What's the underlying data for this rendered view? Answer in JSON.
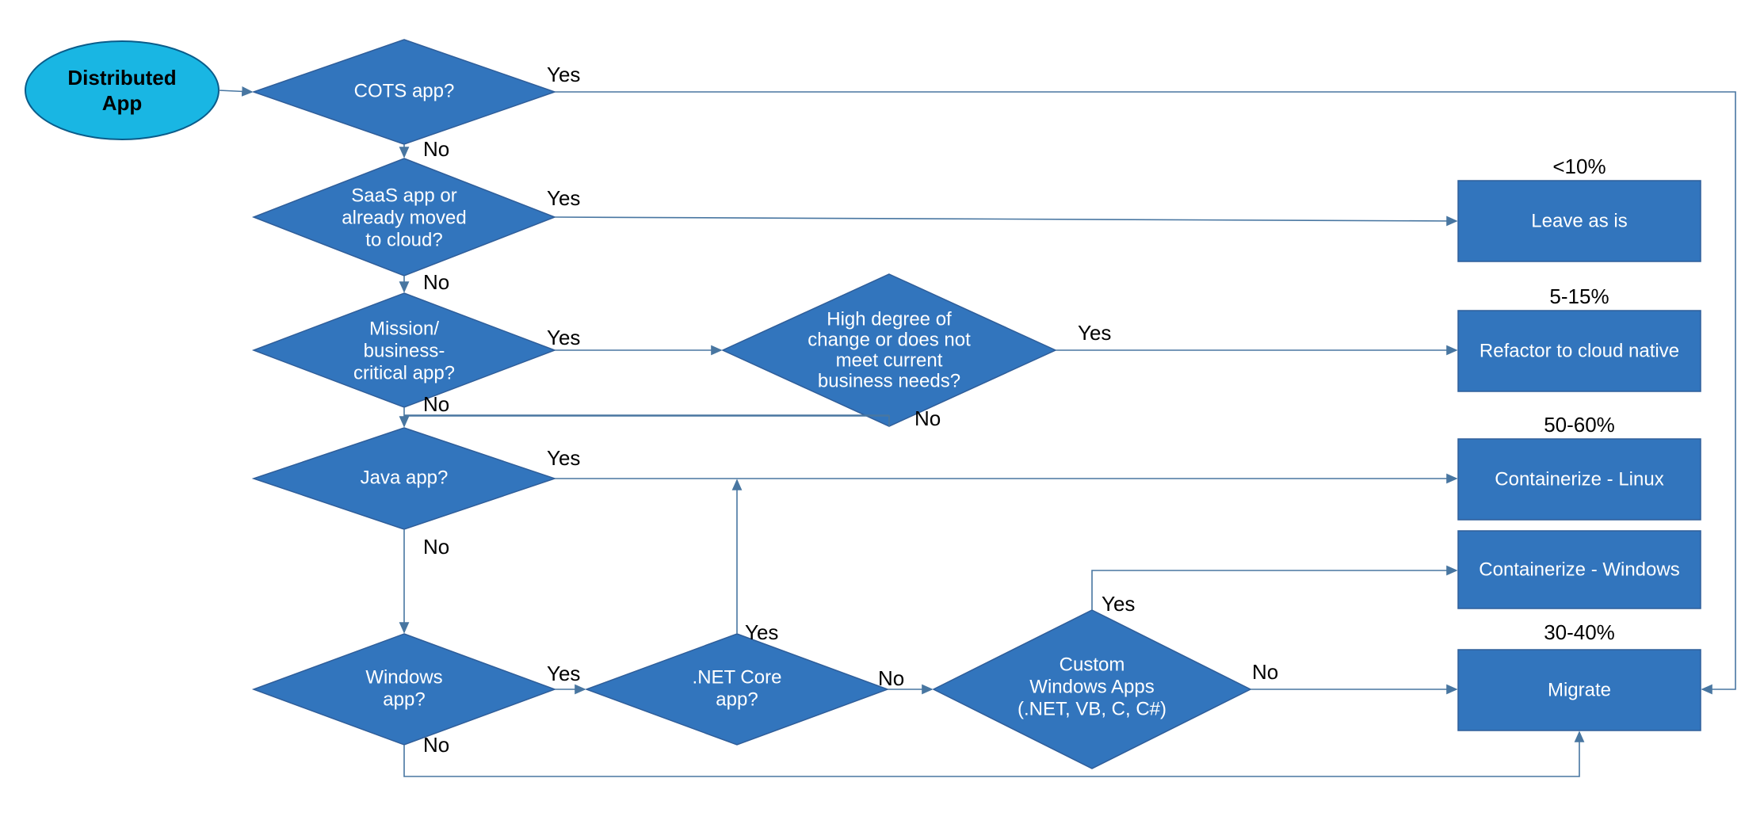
{
  "nodes": {
    "start": {
      "line1": "Distributed",
      "line2": "App"
    },
    "cots": {
      "line1": "COTS app?"
    },
    "saas": {
      "line1": "SaaS app or",
      "line2": "already moved",
      "line3": "to cloud?"
    },
    "mission": {
      "line1": "Mission/",
      "line2": "business-",
      "line3": "critical app?"
    },
    "highchange": {
      "line1": "High degree of",
      "line2": "change or does not",
      "line3": "meet current",
      "line4": "business needs?"
    },
    "java": {
      "line1": "Java app?"
    },
    "windows": {
      "line1": "Windows",
      "line2": "app?"
    },
    "netcore": {
      "line1": ".NET Core",
      "line2": "app?"
    },
    "customwin": {
      "line1": "Custom",
      "line2": "Windows Apps",
      "line3": "(.NET, VB, C, C#)"
    },
    "leave": {
      "label": "Leave as is",
      "pct": "<10%"
    },
    "refactor": {
      "label": "Refactor to cloud native",
      "pct": "5-15%"
    },
    "cont_linux": {
      "label": "Containerize - Linux",
      "pct": "50-60%"
    },
    "cont_win": {
      "label": "Containerize - Windows"
    },
    "migrate": {
      "label": "Migrate",
      "pct": "30-40%"
    }
  },
  "labels": {
    "yes": "Yes",
    "no": "No"
  }
}
